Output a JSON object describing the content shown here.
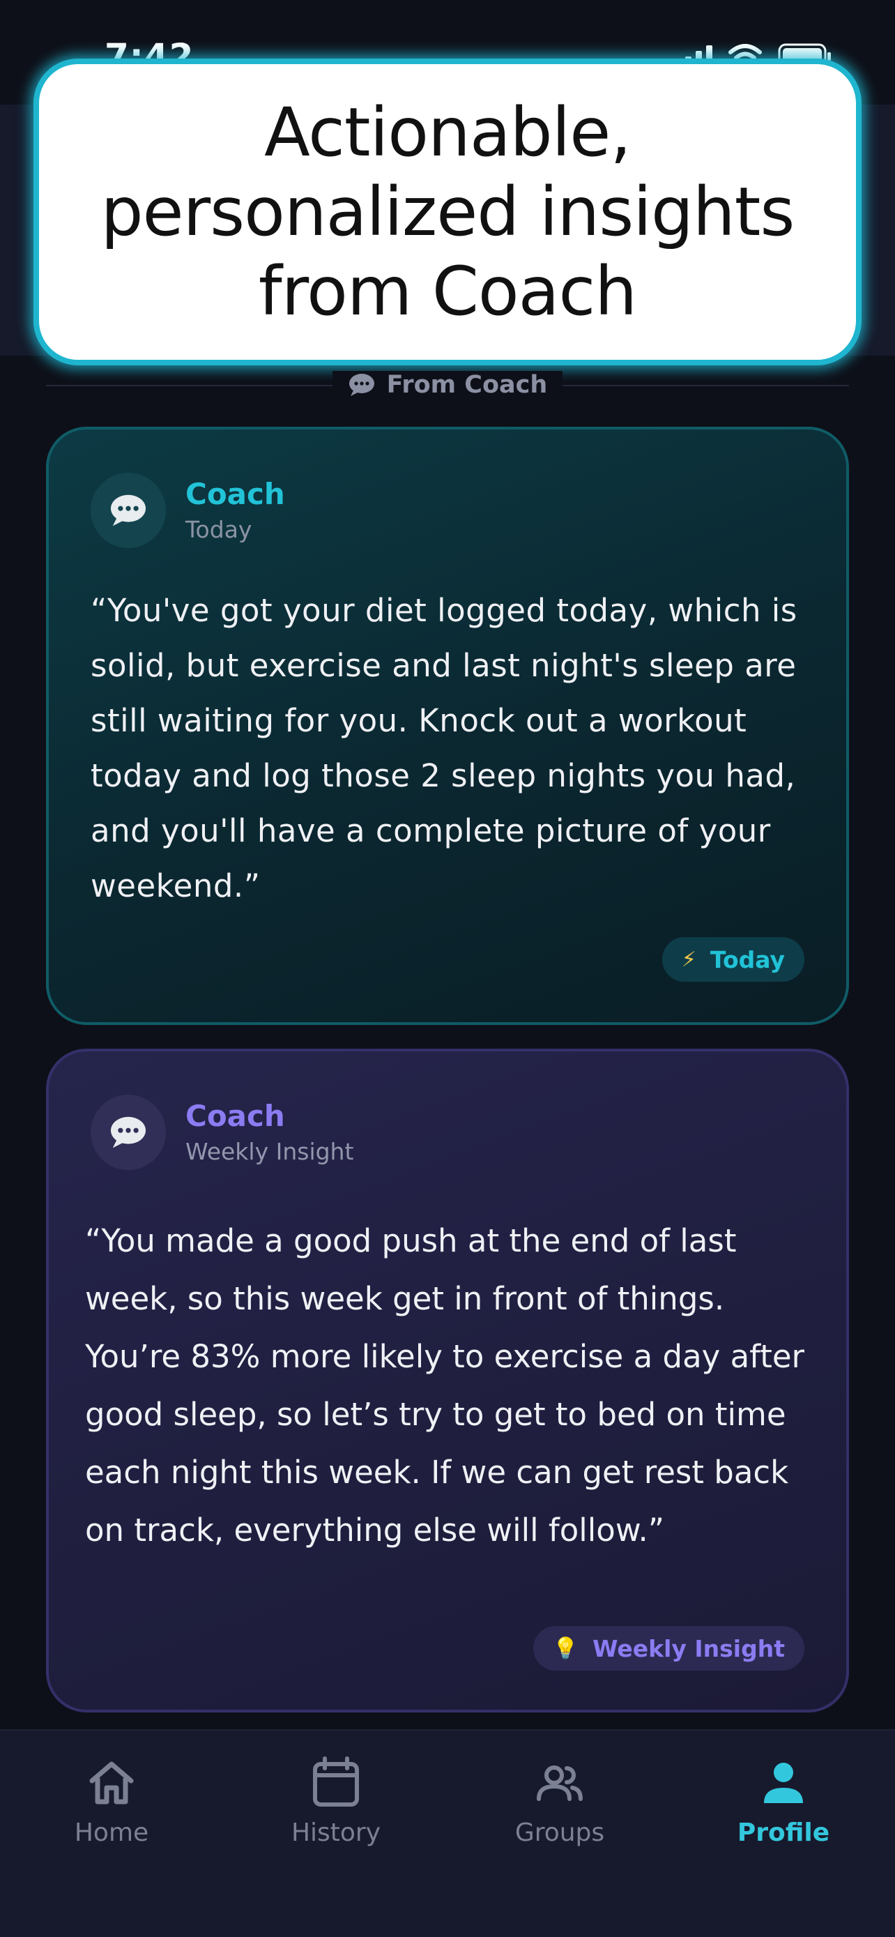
{
  "status_bar": {
    "time": "7:42"
  },
  "banner": {
    "text": "Actionable, personalized insights from Coach"
  },
  "section": {
    "label": "From Coach",
    "icon": "chat-bubble-icon"
  },
  "cards": [
    {
      "name": "Coach",
      "subtitle": "Today",
      "quote": "“You've got your diet logged today, which is solid, but exercise and last night's sleep are still waiting for you. Knock out a workout today and log those 2 sleep nights you had, and you'll have a complete picture of your weekend.”",
      "pill_icon": "⚡",
      "pill_label": "Today",
      "accent": "#22c3d8"
    },
    {
      "name": "Coach",
      "subtitle": "Weekly Insight",
      "quote": "“You made a good push at the end of last week, so this week get in front of things. You’re 83% more likely to exercise a day after good sleep, so let’s try to get to bed on time each night this week. If we can get rest back on track, everything else will follow.”",
      "pill_icon": "💡",
      "pill_label": "Weekly Insight",
      "accent": "#8b7cf2"
    }
  ],
  "tabs": [
    {
      "label": "Home",
      "icon": "home-icon"
    },
    {
      "label": "History",
      "icon": "calendar-icon"
    },
    {
      "label": "Groups",
      "icon": "groups-icon"
    },
    {
      "label": "Profile",
      "icon": "profile-icon",
      "active": true
    }
  ],
  "colors": {
    "background": "#0e1019",
    "banner_border": "#1fb5cf",
    "today_accent": "#22c3d8",
    "weekly_accent": "#8b7cf2",
    "active_tab": "#33c7dd"
  }
}
